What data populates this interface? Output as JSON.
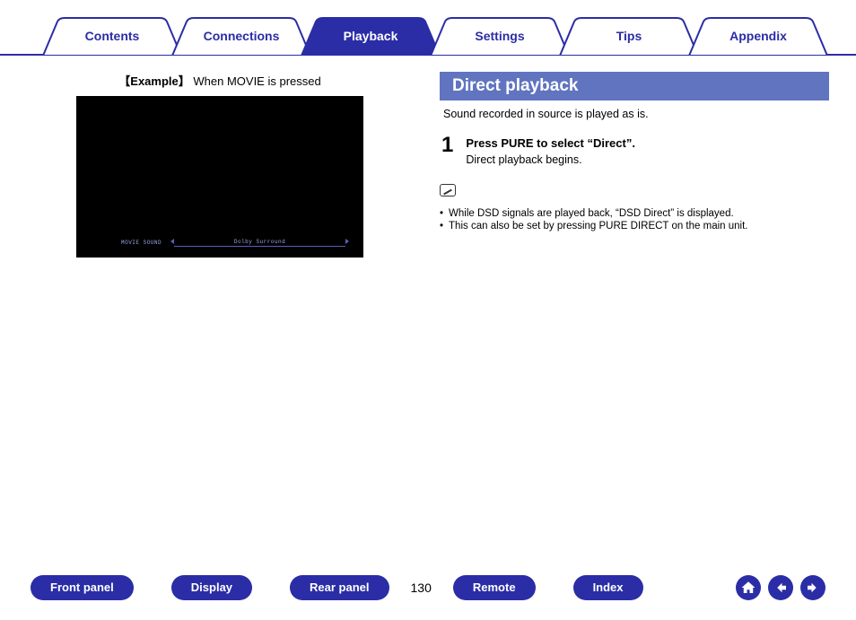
{
  "tabs": {
    "items": [
      {
        "label": "Contents",
        "active": false
      },
      {
        "label": "Connections",
        "active": false
      },
      {
        "label": "Playback",
        "active": true
      },
      {
        "label": "Settings",
        "active": false
      },
      {
        "label": "Tips",
        "active": false
      },
      {
        "label": "Appendix",
        "active": false
      }
    ]
  },
  "left": {
    "example_caption_bold": "【Example】",
    "example_caption_rest": "When MOVIE is pressed",
    "osd_label": "MOVIE SOUND",
    "osd_mode": "Dolby Surround"
  },
  "right": {
    "section_title": "Direct playback",
    "intro": "Sound recorded in source is played as is.",
    "step_number": "1",
    "step_title": "Press PURE to select “Direct”.",
    "step_desc": "Direct playback begins.",
    "notes": [
      "While DSD signals are played back, “DSD Direct” is displayed.",
      "This can also be set by pressing PURE DIRECT on the main unit."
    ]
  },
  "footer": {
    "buttons": [
      "Front panel",
      "Display",
      "Rear panel",
      "Remote",
      "Index"
    ],
    "page": "130"
  }
}
